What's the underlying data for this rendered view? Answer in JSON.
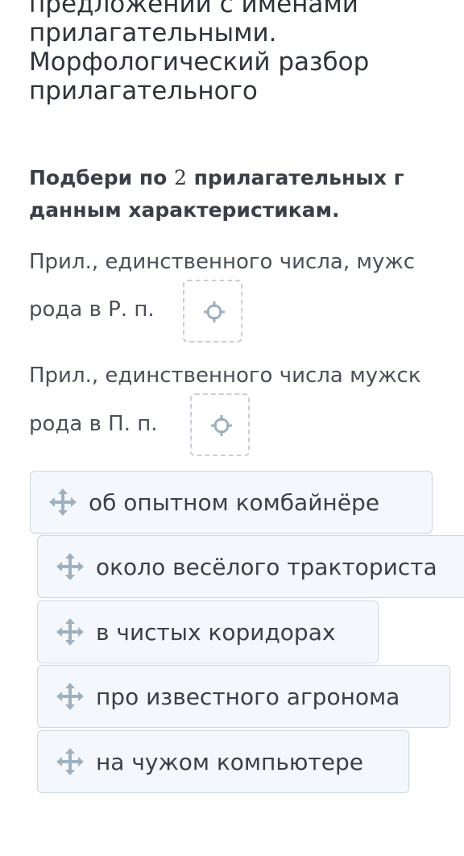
{
  "lesson": {
    "title": "предложений с именами\nприлагательными.\nМорфологический разбор\nприлагательного"
  },
  "task": {
    "prefix": "Подбери по ",
    "count": "2",
    "suffix": " прилагательных г",
    "line2": "данным характеристикам."
  },
  "questions": [
    {
      "line1": "Прил., единственного числа, мужс",
      "line2": "рода в Р. п."
    },
    {
      "line1": "Прил., единственного числа мужск",
      "line2": "рода в П. п."
    }
  ],
  "options": [
    {
      "label": "об опытном комбайнёре"
    },
    {
      "label": "около весёлого тракториста"
    },
    {
      "label": "в чистых коридорах"
    },
    {
      "label": "про известного агронома"
    },
    {
      "label": "на чужом компьютере"
    }
  ],
  "colors": {
    "card_bg": "#f4f8fc",
    "card_border": "#cdd6df",
    "icon": "#9fb0c0"
  },
  "icons": {
    "drop_target": "crosshair-icon",
    "drag_handle": "move-icon"
  }
}
